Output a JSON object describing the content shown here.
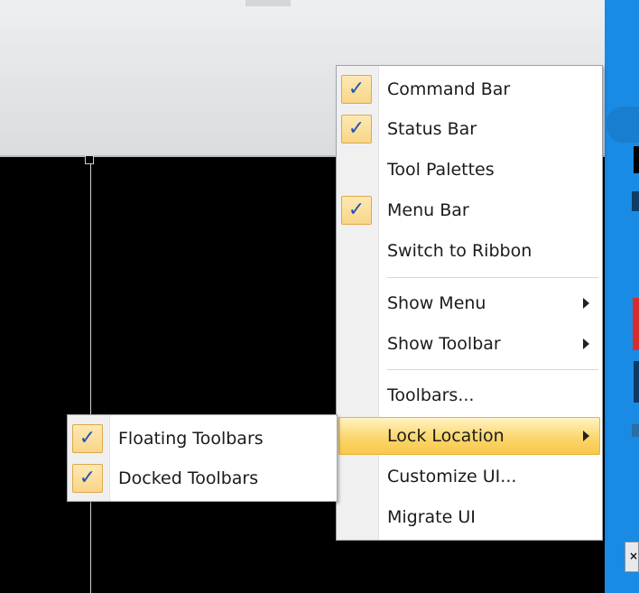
{
  "main_menu": {
    "items": [
      {
        "label": "Command Bar",
        "checked": true
      },
      {
        "label": "Status Bar",
        "checked": true
      },
      {
        "label": "Tool Palettes",
        "checked": false
      },
      {
        "label": "Menu Bar",
        "checked": true
      },
      {
        "label": "Switch to Ribbon",
        "checked": false
      },
      {
        "label": "Show Menu",
        "submenu": true
      },
      {
        "label": "Show Toolbar",
        "submenu": true
      },
      {
        "label": "Toolbars...",
        "checked": false
      },
      {
        "label": "Lock Location",
        "submenu": true,
        "highlighted": true
      },
      {
        "label": "Customize UI...",
        "checked": false
      },
      {
        "label": "Migrate UI",
        "checked": false
      }
    ]
  },
  "lock_submenu": {
    "items": [
      {
        "label": "Floating Toolbars",
        "checked": true
      },
      {
        "label": "Docked Toolbars",
        "checked": true
      }
    ]
  },
  "check_glyph": "✓",
  "colors": {
    "highlight": "#fbd66d",
    "check": "#2154b3",
    "canvas": "#000000",
    "side_strip": "#1a8be5"
  }
}
